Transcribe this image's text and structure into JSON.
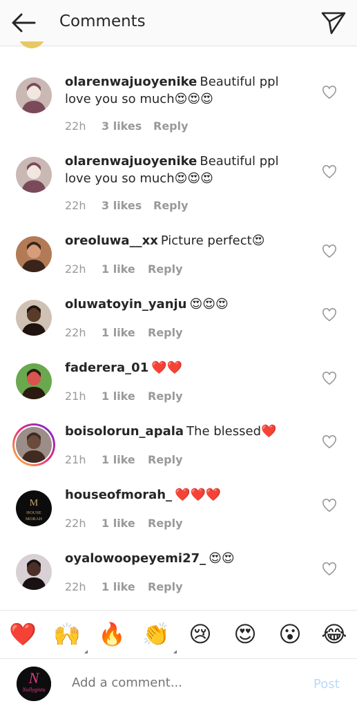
{
  "header": {
    "title": "Comments"
  },
  "comments": [
    {
      "username": "olarenwajuoyenike",
      "text": "Beautiful ppl love you so much",
      "emoji": "😍😍😍",
      "time": "22h",
      "likes": "3 likes",
      "reply": "Reply",
      "avatar": "cake-photo"
    },
    {
      "username": "olarenwajuoyenike",
      "text": "Beautiful ppl love you so much",
      "emoji": "😍😍😍",
      "time": "22h",
      "likes": "3 likes",
      "reply": "Reply",
      "avatar": "cake-photo"
    },
    {
      "username": "oreoluwa__xx",
      "text": "Picture perfect",
      "emoji": "😍",
      "time": "22h",
      "likes": "1 like",
      "reply": "Reply",
      "avatar": "portrait"
    },
    {
      "username": "oluwatoyin_yanju",
      "text": "",
      "emoji": "😍😍😍",
      "time": "22h",
      "likes": "1 like",
      "reply": "Reply",
      "avatar": "portrait-dark"
    },
    {
      "username": "faderera_01",
      "text": "",
      "emoji": "❤️❤️",
      "time": "21h",
      "likes": "1 like",
      "reply": "Reply",
      "avatar": "portrait-colorful"
    },
    {
      "username": "boisolorun_apala",
      "text": "The blessed",
      "emoji": "❤️",
      "time": "21h",
      "likes": "1 like",
      "reply": "Reply",
      "avatar": "portrait-hat"
    },
    {
      "username": "houseofmorah_",
      "text": "",
      "emoji": "❤️❤️❤️",
      "time": "22h",
      "likes": "1 like",
      "reply": "Reply",
      "avatar": "house-of-morah-logo"
    },
    {
      "username": "oyalowoopeyemi27_",
      "text": "",
      "emoji": "😍😍",
      "time": "22h",
      "likes": "1 like",
      "reply": "Reply",
      "avatar": "portrait-woman"
    }
  ],
  "avatar_logo_text": {
    "top": "M",
    "line1": "HOUSE",
    "line2": "MORAH"
  },
  "reactions": [
    {
      "glyph": "❤️",
      "name": "heart"
    },
    {
      "glyph": "🙌",
      "name": "raised-hands"
    },
    {
      "glyph": "🔥",
      "name": "fire"
    },
    {
      "glyph": "👏",
      "name": "clapping-hands"
    },
    {
      "glyph": "😢",
      "name": "crying-face"
    },
    {
      "glyph": "😍",
      "name": "heart-eyes"
    },
    {
      "glyph": "😮",
      "name": "surprised-face"
    },
    {
      "glyph": "😂",
      "name": "tears-of-joy"
    }
  ],
  "composer": {
    "placeholder": "Add a comment...",
    "post_label": "Post",
    "avatar_brand": "Nollygistu"
  },
  "colors": {
    "post_disabled": "#b6dafb",
    "meta": "#999999",
    "ring_start": "#f9ce34",
    "ring_end": "#6228d7"
  }
}
